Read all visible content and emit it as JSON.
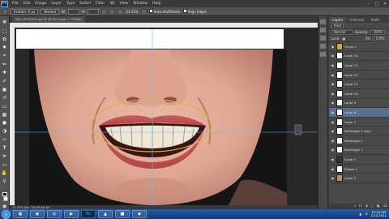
{
  "menubar": {
    "logo": "Ps",
    "items": [
      "File",
      "Edit",
      "Image",
      "Layer",
      "Type",
      "Select",
      "Filter",
      "3D",
      "View",
      "Window",
      "Help"
    ]
  },
  "options": {
    "preset": "Feather: 0 px",
    "style": "Normal",
    "width_label": "W:",
    "height_label": "H:",
    "zoom": "33.33%",
    "auto_add": "Auto-Add/Delete",
    "align_edges": "Align Edges"
  },
  "doc_tab": "IMG_20191201.jpg @ 33.3% (Layer 1, RGB/8)",
  "status": "33.33%  Doc: 26.2M/96.4M",
  "layers_panel": {
    "tabs": [
      "Layers",
      "Channels",
      "Paths"
    ],
    "kind": "Kind",
    "blend": "Normal",
    "opacity_label": "Opacity:",
    "opacity_value": "100%",
    "lock_label": "Lock:",
    "fill_label": "Fill:",
    "fill_value": "100%",
    "layers": [
      {
        "name": "Group 1",
        "selected": false
      },
      {
        "name": "Layer 14",
        "selected": false
      },
      {
        "name": "Layer 13",
        "selected": false
      },
      {
        "name": "Layer 12",
        "selected": false
      },
      {
        "name": "Layer 11",
        "selected": false
      },
      {
        "name": "Layer 10",
        "selected": false
      },
      {
        "name": "Layer 9",
        "selected": false
      },
      {
        "name": "Layer 8",
        "selected": true
      },
      {
        "name": "Layer 7",
        "selected": false
      },
      {
        "name": "Rectangle 2 copy",
        "selected": false
      },
      {
        "name": "Rectangle 2",
        "selected": false
      },
      {
        "name": "Rectangle 1",
        "selected": false
      },
      {
        "name": "Layer 1",
        "selected": false
      },
      {
        "name": "Ellipse 1",
        "selected": false
      },
      {
        "name": "Layer 0",
        "selected": false
      }
    ]
  },
  "taskbar": {
    "time": "10:24 AM",
    "date": "2/11/2021"
  },
  "colors": {
    "accent": "#5a6f8f",
    "guide": "#6fb7ff",
    "ellipse": "#d9b24a"
  }
}
